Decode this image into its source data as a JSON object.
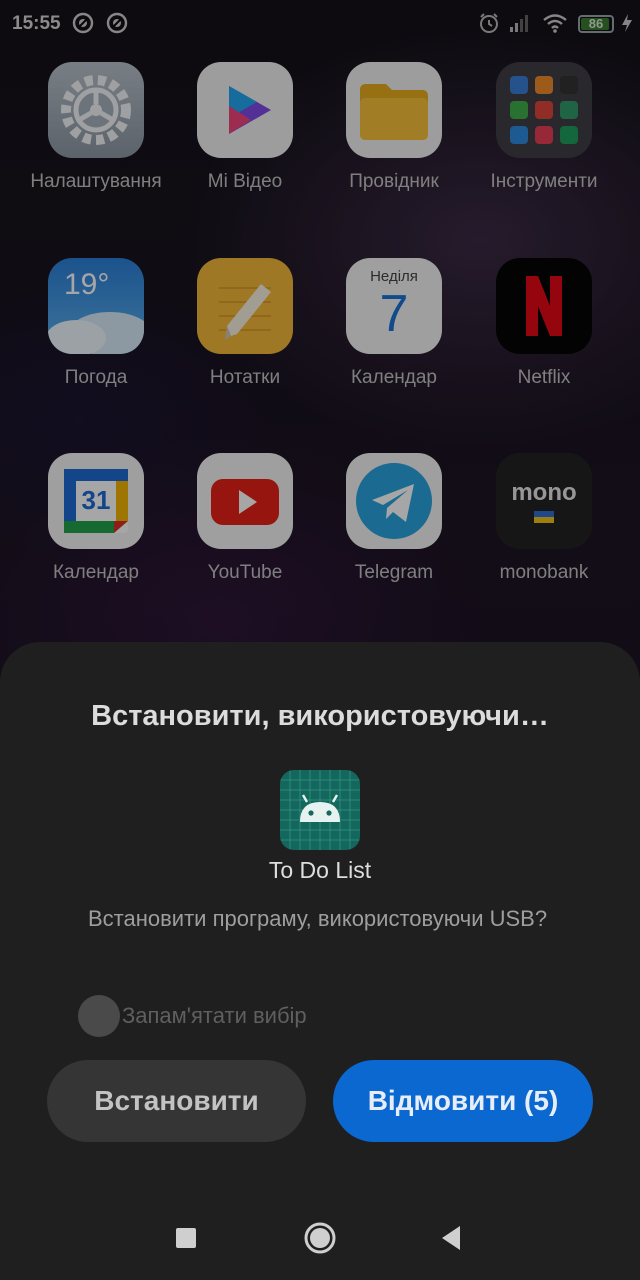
{
  "status_bar": {
    "time": "15:55",
    "battery_level": "86",
    "icons": [
      "notification-circle-icon",
      "notification-circle-icon",
      "alarm-icon",
      "cellular-signal-icon",
      "wifi-icon",
      "battery-icon",
      "charging-bolt-icon"
    ]
  },
  "home_apps": [
    {
      "label": "Налаштування",
      "icon": "settings-gear-icon"
    },
    {
      "label": "Mi Відео",
      "icon": "mi-video-icon"
    },
    {
      "label": "Провідник",
      "icon": "folder-icon"
    },
    {
      "label": "Інструменти",
      "icon": "tools-folder-icon"
    },
    {
      "label": "Погода",
      "icon": "weather-icon",
      "badge": "19°"
    },
    {
      "label": "Нотатки",
      "icon": "notes-icon"
    },
    {
      "label": "Календар",
      "icon": "calendar-icon",
      "day_name": "Неділя",
      "day_number": "7"
    },
    {
      "label": "Netflix",
      "icon": "netflix-icon"
    },
    {
      "label": "Календар",
      "icon": "google-calendar-icon",
      "day_number": "31"
    },
    {
      "label": "YouTube",
      "icon": "youtube-icon"
    },
    {
      "label": "Telegram",
      "icon": "telegram-icon"
    },
    {
      "label": "monobank",
      "icon": "monobank-icon",
      "logo_text": "mono"
    }
  ],
  "dialog": {
    "title": "Встановити, використовуючи…",
    "package_name": "To Do List",
    "message": "Встановити програму, використовуючи USB?",
    "remember_label": "Запам'ятати вибір",
    "install_label": "Встановити",
    "cancel_label": "Відмовити (5)"
  },
  "colors": {
    "accent": "#0a68d0",
    "sheet_background": "#1f1f1f",
    "package_icon": "#14675c"
  },
  "nav_bar": [
    "recents-square-icon",
    "home-circle-icon",
    "back-triangle-icon"
  ]
}
